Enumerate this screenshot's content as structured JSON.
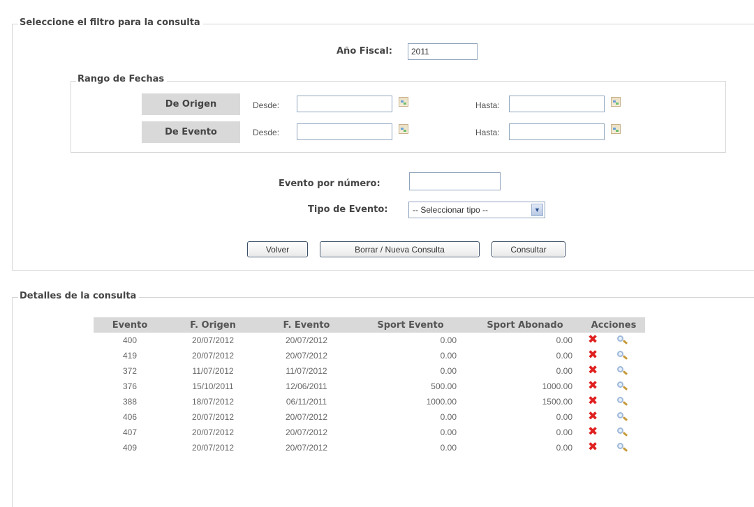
{
  "filter": {
    "legend": "Seleccione el filtro para la consulta",
    "fiscal_year_label": "Año Fiscal:",
    "fiscal_year_value": "2011",
    "date_range": {
      "legend": "Rango de Fechas",
      "origin_label": "De Origen",
      "event_label": "De Evento",
      "from_label": "Desde:",
      "to_label": "Hasta:",
      "origin_from": "",
      "origin_to": "",
      "event_from": "",
      "event_to": ""
    },
    "event_number_label": "Evento por número:",
    "event_number_value": "",
    "event_type_label": "Tipo de Evento:",
    "event_type_selected": "-- Seleccionar tipo --",
    "buttons": {
      "back": "Volver",
      "clear": "Borrar / Nueva Consulta",
      "query": "Consultar"
    }
  },
  "details": {
    "legend": "Detalles de la consulta",
    "columns": [
      "Evento",
      "F. Origen",
      "F. Evento",
      "Sport Evento",
      "Sport Abonado",
      "Acciones"
    ],
    "rows": [
      {
        "evento": "400",
        "f_origen": "20/07/2012",
        "f_evento": "20/07/2012",
        "sport_evento": "0.00",
        "sport_abonado": "0.00"
      },
      {
        "evento": "419",
        "f_origen": "20/07/2012",
        "f_evento": "20/07/2012",
        "sport_evento": "0.00",
        "sport_abonado": "0.00"
      },
      {
        "evento": "372",
        "f_origen": "11/07/2012",
        "f_evento": "11/07/2012",
        "sport_evento": "0.00",
        "sport_abonado": "0.00"
      },
      {
        "evento": "376",
        "f_origen": "15/10/2011",
        "f_evento": "12/06/2011",
        "sport_evento": "500.00",
        "sport_abonado": "1000.00"
      },
      {
        "evento": "388",
        "f_origen": "18/07/2012",
        "f_evento": "06/11/2011",
        "sport_evento": "1000.00",
        "sport_abonado": "1500.00"
      },
      {
        "evento": "406",
        "f_origen": "20/07/2012",
        "f_evento": "20/07/2012",
        "sport_evento": "0.00",
        "sport_abonado": "0.00"
      },
      {
        "evento": "407",
        "f_origen": "20/07/2012",
        "f_evento": "20/07/2012",
        "sport_evento": "0.00",
        "sport_abonado": "0.00"
      },
      {
        "evento": "409",
        "f_origen": "20/07/2012",
        "f_evento": "20/07/2012",
        "sport_evento": "0.00",
        "sport_abonado": "0.00"
      }
    ],
    "delete_glyph": "✖",
    "icons": [
      "delete-icon",
      "view-icon"
    ]
  }
}
